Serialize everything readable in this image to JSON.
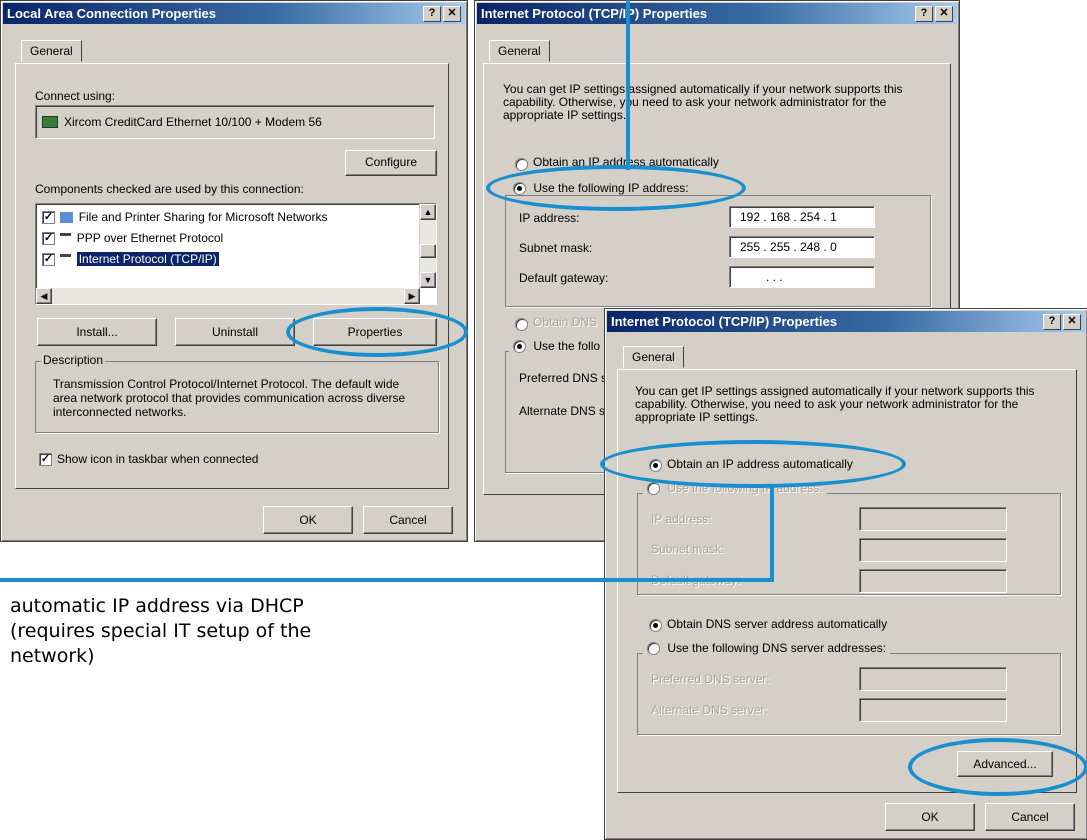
{
  "win1": {
    "title": "Local Area Connection Properties",
    "tab": "General",
    "connect_using": "Connect using:",
    "adapter": "Xircom CreditCard Ethernet 10/100 + Modem 56",
    "configure": "Configure",
    "components_label": "Components checked are used by this connection:",
    "components": [
      {
        "label": "File and Printer Sharing for Microsoft Networks",
        "checked": true
      },
      {
        "label": "PPP over Ethernet Protocol",
        "checked": true
      },
      {
        "label": "Internet Protocol (TCP/IP)",
        "checked": true
      }
    ],
    "install": "Install...",
    "uninstall": "Uninstall",
    "properties": "Properties",
    "description_legend": "Description",
    "description": "Transmission Control Protocol/Internet Protocol. The default wide area network protocol that provides communication across diverse interconnected networks.",
    "show_icon": "Show icon in taskbar when connected",
    "ok": "OK",
    "cancel": "Cancel"
  },
  "win2": {
    "title": "Internet Protocol (TCP/IP) Properties",
    "tab": "General",
    "intro": "You can get IP settings assigned automatically if your network supports this capability. Otherwise, you need to ask your network administrator for the appropriate IP settings.",
    "obtain_auto": "Obtain an IP address automatically",
    "use_following": "Use the following IP address:",
    "ip_label": "IP address:",
    "ip_value": "192 . 168 . 254 .  1",
    "subnet_label": "Subnet mask:",
    "subnet_value": "255 . 255 . 248 .  0",
    "gateway_label": "Default gateway:",
    "gateway_value": ".      .      .",
    "dns_auto": "Obtain DNS",
    "dns_use": "Use the follo",
    "preferred": "Preferred DNS s",
    "alternate": "Alternate DNS s"
  },
  "win3": {
    "title": "Internet Protocol (TCP/IP) Properties",
    "tab": "General",
    "intro": "You can get IP settings assigned automatically if your network supports this capability. Otherwise, you need to ask your network administrator for the appropriate IP settings.",
    "obtain_auto": "Obtain an IP address automatically",
    "use_following": "Use the following IP address:",
    "ip_label": "IP address:",
    "subnet_label": "Subnet mask:",
    "gateway_label": "Default gateway:",
    "dns_auto": "Obtain DNS server address automatically",
    "dns_use": "Use the following DNS server addresses:",
    "preferred": "Preferred DNS server:",
    "alternate": "Alternate DNS server:",
    "advanced": "Advanced...",
    "ok": "OK",
    "cancel": "Cancel"
  },
  "annotation": "automatic IP address via DHCP (requires special IT setup of the network)",
  "highlight_color": "#1a8fd0"
}
